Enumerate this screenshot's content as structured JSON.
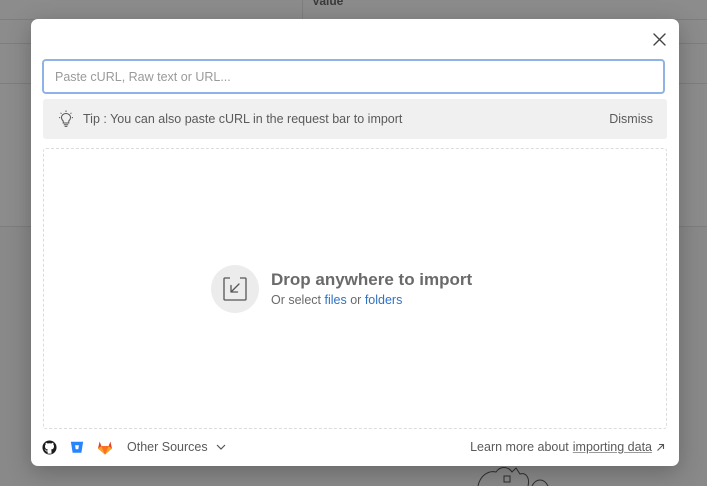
{
  "background": {
    "header_text": "Value"
  },
  "import_modal": {
    "input": {
      "placeholder": "Paste cURL, Raw text or URL...",
      "value": ""
    },
    "tip": {
      "text": "Tip : You can also paste cURL in the request bar to import",
      "dismiss_label": "Dismiss"
    },
    "dropzone": {
      "title": "Drop anywhere to import",
      "prefix": "Or select",
      "files_label": "files",
      "or_label": "or",
      "folders_label": "folders"
    },
    "footer": {
      "sources": [
        {
          "icon": "github-icon"
        },
        {
          "icon": "bitbucket-icon"
        },
        {
          "icon": "gitlab-icon"
        }
      ],
      "other_sources_label": "Other Sources",
      "learn_more_prefix": "Learn more about",
      "learn_more_link": "importing data"
    }
  },
  "colors": {
    "accent_link": "#2f72c4",
    "input_focus_border": "#8fb3e6",
    "gitlab_orange": "#e2432a",
    "bitbucket_blue": "#2684ff"
  }
}
